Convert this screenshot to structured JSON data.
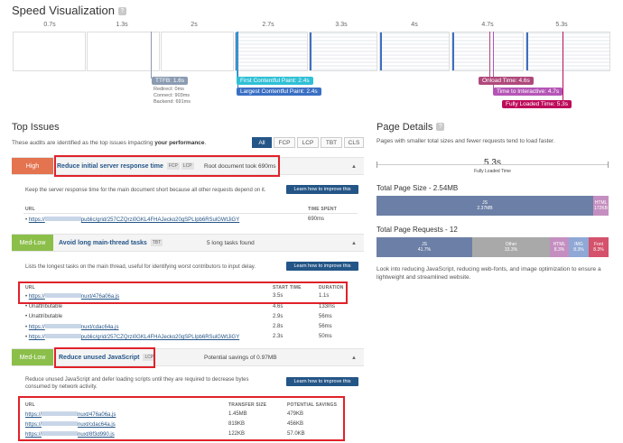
{
  "speed": {
    "title": "Speed Visualization",
    "help": "?",
    "ticks": [
      "0.7s",
      "1.3s",
      "2s",
      "2.7s",
      "3.3s",
      "4s",
      "4.7s",
      "5.3s"
    ],
    "ttfb": {
      "label": "TTFB: 1.6s",
      "redirect": "Redirect: 0ms",
      "connect": "Connect: 903ms",
      "backend": "Backend: 691ms"
    },
    "fcp": "First Contentful Paint: 2.4s",
    "lcp": "Largest Contentful Paint: 2.4s",
    "onload": "Onload Time: 4.6s",
    "tti": "Time to Interactive: 4.7s",
    "fully_loaded": "Fully Loaded Time: 5.3s",
    "colors": {
      "ttfb": "#8a9bb2",
      "fcp": "#2fc0d6",
      "lcp": "#3a6fc4",
      "onload": "#b0497b",
      "tti": "#b455b6",
      "fully": "#bd0b5a"
    }
  },
  "top_issues": {
    "title": "Top Issues",
    "description_pre": "These audits are identified as the top issues impacting ",
    "description_bold": "your performance",
    "description_post": ".",
    "filters": [
      "All",
      "FCP",
      "LCP",
      "TBT",
      "CLS"
    ],
    "issues": [
      {
        "severity": "High",
        "name": "Reduce initial server response time",
        "tags": [
          "FCP",
          "LCP"
        ],
        "summary": "Root document took 690ms",
        "body": "Keep the server response time for the main document short because all other requests depend on it.",
        "learn": "Learn how to improve this",
        "headers": [
          "URL",
          "TIME SPENT"
        ],
        "rows": [
          {
            "url_pre": "https://",
            "url_post": "public/grid/257CZQrzi0GKL4FHAJecko20gSPLIpb6RSulGWtJiGY",
            "v1": "690ms"
          }
        ]
      },
      {
        "severity": "Med-Low",
        "name": "Avoid long main-thread tasks",
        "tags": [
          "TBT"
        ],
        "summary": "5 long tasks found",
        "body": "Lists the longest tasks on the main thread, useful for identifying worst contributors to input delay.",
        "learn": "Learn how to improve this",
        "headers": [
          "URL",
          "START TIME",
          "DURATION"
        ],
        "rows": [
          {
            "url_pre": "https://",
            "url_post": "nuxt/476a06a.js",
            "v1": "3.5s",
            "v2": "1.1s"
          },
          {
            "url_pre": "Unattributable",
            "url_post": "",
            "v1": "4.6s",
            "v2": "133ms"
          },
          {
            "url_pre": "Unattributable",
            "url_post": "",
            "v1": "2.9s",
            "v2": "56ms"
          },
          {
            "url_pre": "https://",
            "url_post": "nuxt/cdac64a.js",
            "v1": "2.8s",
            "v2": "56ms"
          },
          {
            "url_pre": "https://",
            "url_post": "public/grid/257CZQrzi0GKL4FHAJecko20gSPLIpb6RSulGWtJiGY",
            "v1": "2.3s",
            "v2": "50ms"
          }
        ]
      },
      {
        "severity": "Med-Low",
        "name": "Reduce unused JavaScript",
        "tags": [
          "LCP"
        ],
        "summary": "Potential savings of 0.97MB",
        "body": "Reduce unused JavaScript and defer loading scripts until they are required to decrease bytes consumed by network activity.",
        "learn": "Learn how to improve this",
        "headers": [
          "URL",
          "TRANSFER SIZE",
          "POTENTIAL SAVINGS"
        ],
        "rows": [
          {
            "url_pre": "https://",
            "url_post": "nuxt/476a06a.js",
            "v1": "1.45MB",
            "v2": "479KB"
          },
          {
            "url_pre": "https://",
            "url_post": "nuxt/cdac64a.js",
            "v1": "819KB",
            "v2": "456KB"
          },
          {
            "url_pre": "https://",
            "url_post": "nuxt/8f3d990.js",
            "v1": "122KB",
            "v2": "57.0KB"
          }
        ]
      }
    ]
  },
  "page_details": {
    "title": "Page Details",
    "description": "Pages with smaller total sizes and fewer requests tend to load faster.",
    "fully_loaded_value": "5.3s",
    "fully_loaded_label": "Fully Loaded Time",
    "size_title": "Total Page Size - 2.54MB",
    "size_segments": [
      {
        "name": "JS",
        "value": "2.37MB",
        "color": "#6c7fa6"
      },
      {
        "name": "HTML",
        "value": "172KB",
        "color": "#c48fc0"
      }
    ],
    "requests_title": "Total Page Requests - 12",
    "request_segments": [
      {
        "name": "JS",
        "value": "41.7%",
        "color": "#6c7fa6"
      },
      {
        "name": "Other",
        "value": "33.3%",
        "color": "#a9a9a9"
      },
      {
        "name": "HTML",
        "value": "8.3%",
        "color": "#c48fc0"
      },
      {
        "name": "IMG",
        "value": "8.3%",
        "color": "#8fa8d6"
      },
      {
        "name": "Font",
        "value": "8.3%",
        "color": "#d4526b"
      }
    ],
    "note": "Look into reducing JavaScript, reducing web-fonts, and image optimization to ensure a lightweight and streamlined website."
  }
}
